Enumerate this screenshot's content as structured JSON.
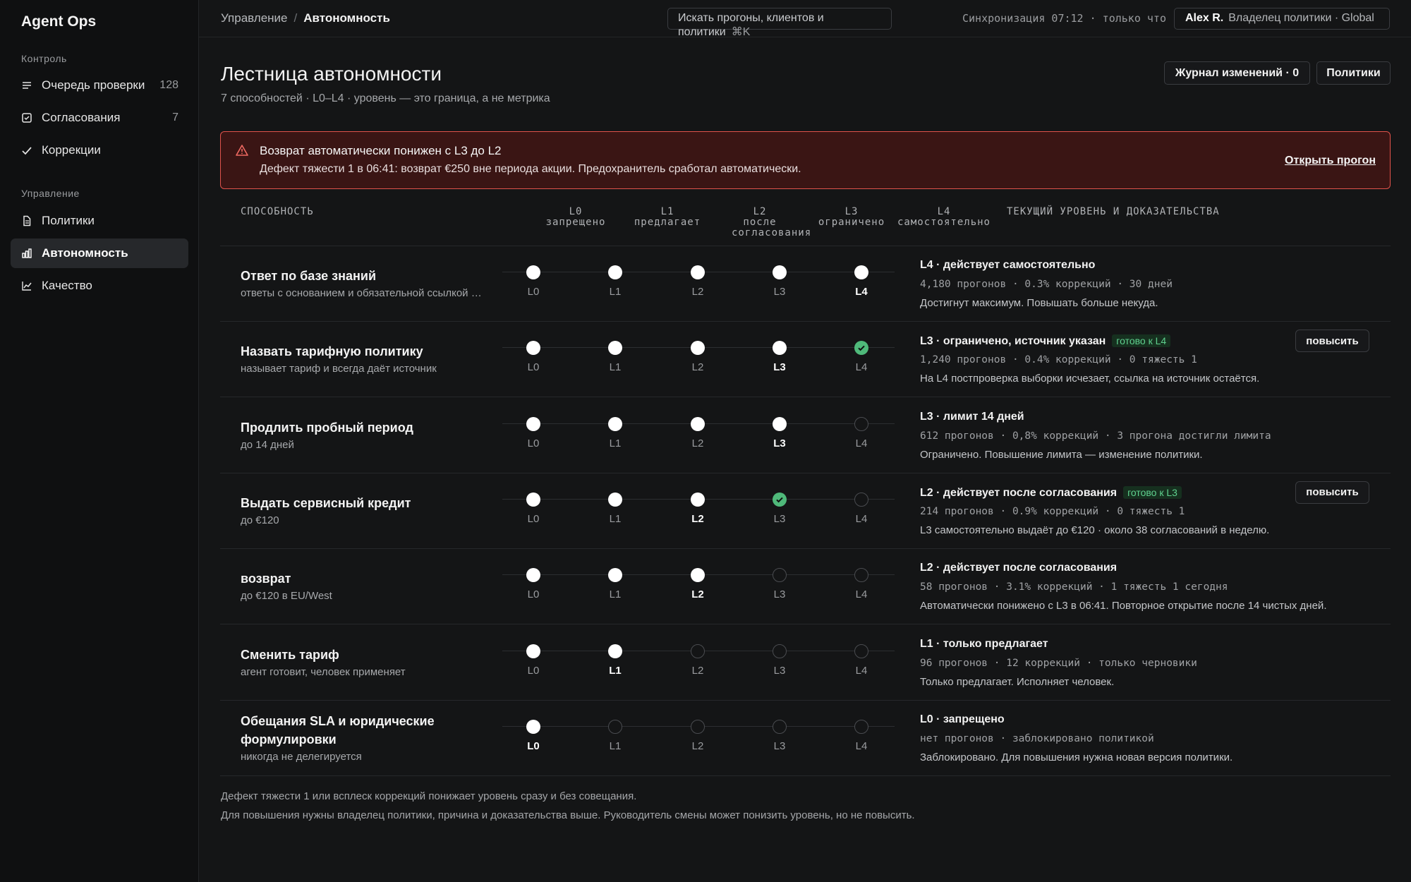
{
  "app": {
    "brand": "Agent Ops"
  },
  "sidebar": {
    "sections": [
      {
        "title": "Контроль",
        "items": [
          {
            "label": "Очередь проверки",
            "count": "128",
            "icon": "list-icon"
          },
          {
            "label": "Согласования",
            "count": "7",
            "icon": "checkbox-icon"
          },
          {
            "label": "Коррекции",
            "count": "",
            "icon": "check-icon"
          }
        ]
      },
      {
        "title": "Управление",
        "items": [
          {
            "label": "Политики",
            "count": "",
            "icon": "document-icon"
          },
          {
            "label": "Автономность",
            "count": "",
            "icon": "bar-chart-icon",
            "active": true
          },
          {
            "label": "Качество",
            "count": "",
            "icon": "line-chart-icon"
          }
        ]
      }
    ]
  },
  "topbar": {
    "breadcrumb": {
      "parent": "Управление",
      "separator": "/",
      "current": "Автономность"
    },
    "search": {
      "placeholder": "Искать прогоны, клиентов и политики",
      "shortcut": "⌘K"
    },
    "sync": "Синхронизация 07:12 · только что",
    "user": {
      "name": "Alex R.",
      "role": "Владелец политики · Global"
    }
  },
  "header": {
    "title": "Лестница автономности",
    "subtitle": "7 способностей · L0–L4 · уровень — это граница, а не метрика",
    "changelog_label": "Журнал изменений · 0",
    "policies_label": "Политики"
  },
  "alert": {
    "title": "Возврат автоматически понижен с L3 до L2",
    "text": "Дефект тяжести 1 в 06:41: возврат €250 вне периода акции. Предохранитель сработал автоматически.",
    "link": "Открыть прогон"
  },
  "table": {
    "col_capability": "СПОСОБНОСТЬ",
    "levels": [
      {
        "code": "L0",
        "label": "запрещено"
      },
      {
        "code": "L1",
        "label": "предлагает"
      },
      {
        "code": "L2",
        "label": "после согласования"
      },
      {
        "code": "L3",
        "label": "ограничено"
      },
      {
        "code": "L4",
        "label": "самостоятельно"
      }
    ],
    "col_status": "ТЕКУЩИЙ УРОВЕНЬ И ДОКАЗАТЕЛЬСТВА",
    "level_codes": [
      "L0",
      "L1",
      "L2",
      "L3",
      "L4"
    ],
    "promote_label": "повысить",
    "rows": [
      {
        "name": "Ответ по базе знаний",
        "desc": "ответы с основанием и обязательной ссылкой на источник",
        "current": 4,
        "ready": null,
        "status": "L4 · действует самостоятельно",
        "badge": "",
        "meta": "4,180 прогонов · 0.3% коррекций · 30 дней",
        "note": "Достигнут максимум. Повышать больше некуда.",
        "promote": false
      },
      {
        "name": "Назвать тарифную политику",
        "desc": "называет тариф и всегда даёт источник",
        "current": 3,
        "ready": 4,
        "status": "L3 · ограничено, источник указан",
        "badge": "готово к L4",
        "meta": "1,240 прогонов · 0.4% коррекций · 0 тяжесть 1",
        "note": "На L4 постпроверка выборки исчезает, ссылка на источник остаётся.",
        "promote": true
      },
      {
        "name": "Продлить пробный период",
        "desc": "до 14 дней",
        "current": 3,
        "ready": null,
        "status": "L3 · лимит 14 дней",
        "badge": "",
        "meta": "612 прогонов · 0,8% коррекций · 3 прогона достигли лимита",
        "note": "Ограничено. Повышение лимита — изменение политики.",
        "promote": false
      },
      {
        "name": "Выдать сервисный кредит",
        "desc": "до €120",
        "current": 2,
        "ready": 3,
        "status": "L2 · действует после согласования",
        "badge": "готово к L3",
        "meta": "214 прогонов · 0.9% коррекций · 0 тяжесть 1",
        "note": "L3 самостоятельно выдаёт до €120 · около 38 согласований в неделю.",
        "promote": true
      },
      {
        "name": "возврат",
        "desc": "до €120 в EU/West",
        "current": 2,
        "ready": null,
        "status": "L2 · действует после согласования",
        "badge": "",
        "meta": "58 прогонов · 3.1% коррекций · 1 тяжесть 1 сегодня",
        "note": "Автоматически понижено с L3 в 06:41. Повторное открытие после 14 чистых дней.",
        "promote": false
      },
      {
        "name": "Сменить тариф",
        "desc": "агент готовит, человек применяет",
        "current": 1,
        "ready": null,
        "status": "L1 · только предлагает",
        "badge": "",
        "meta": "96 прогонов · 12 коррекций · только черновики",
        "note": "Только предлагает. Исполняет человек.",
        "promote": false
      },
      {
        "name": "Обещания SLA и юридические формулировки",
        "desc": "никогда не делегируется",
        "current": 0,
        "ready": null,
        "status": "L0 · запрещено",
        "badge": "",
        "meta": "нет прогонов · заблокировано политикой",
        "note": "Заблокировано. Для повышения нужна новая версия политики.",
        "promote": false
      }
    ]
  },
  "footer": {
    "line1": "Дефект тяжести 1 или всплеск коррекций понижает уровень сразу и без совещания.",
    "line2": "Для повышения нужны владелец политики, причина и доказательства выше. Руководитель смены может понизить уровень, но не повысить."
  },
  "colors": {
    "accent_green": "#4fb97a",
    "alert_border": "#e0524b",
    "alert_bg": "#3a1514"
  }
}
